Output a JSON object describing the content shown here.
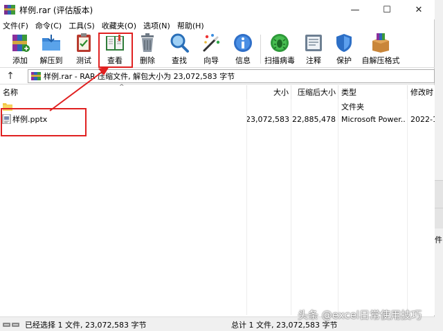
{
  "window": {
    "title": "样例.rar (评估版本)",
    "controls": {
      "minimize": "—",
      "maximize": "☐",
      "close": "✕"
    }
  },
  "menu": [
    "文件(F)",
    "命令(C)",
    "工具(S)",
    "收藏夹(O)",
    "选项(N)",
    "帮助(H)"
  ],
  "toolbar": [
    {
      "label": "添加",
      "icon": "add-archive-icon"
    },
    {
      "label": "解压到",
      "icon": "extract-folder-icon"
    },
    {
      "label": "测试",
      "icon": "test-clipboard-icon"
    },
    {
      "label": "查看",
      "icon": "view-book-icon"
    },
    {
      "label": "删除",
      "icon": "trash-icon"
    },
    {
      "label": "查找",
      "icon": "magnifier-icon"
    },
    {
      "label": "向导",
      "icon": "wizard-wand-icon"
    },
    {
      "label": "信息",
      "icon": "info-icon"
    },
    {
      "label": "扫描病毒",
      "icon": "virus-scan-icon"
    },
    {
      "label": "注释",
      "icon": "comment-icon"
    },
    {
      "label": "保护",
      "icon": "shield-icon"
    },
    {
      "label": "自解压格式",
      "icon": "sfx-box-icon"
    }
  ],
  "address": {
    "up": "↑",
    "text": "样例.rar - RAR 压缩文件, 解包大小为 23,072,583 字节"
  },
  "columns": {
    "name": "名称",
    "size": "大小",
    "packed": "压缩后大小",
    "type": "类型",
    "modified": "修改时"
  },
  "sort_indicator": "^",
  "rows": [
    {
      "name": "..",
      "size": "",
      "packed": "",
      "type": "文件夹",
      "modified": ""
    },
    {
      "name": "样例.pptx",
      "size": "23,072,583",
      "packed": "22,885,478",
      "type": "Microsoft Power...",
      "modified": "2022-1"
    }
  ],
  "status": {
    "left": "已经选择 1 文件, 23,072,583 字节",
    "right": "总计 1 文件, 23,072,583 字节"
  },
  "side_char": "件",
  "watermark": "头条 @excel日常使用技巧",
  "colors": {
    "annotation": "#e02020",
    "folder": "#f3c744"
  }
}
